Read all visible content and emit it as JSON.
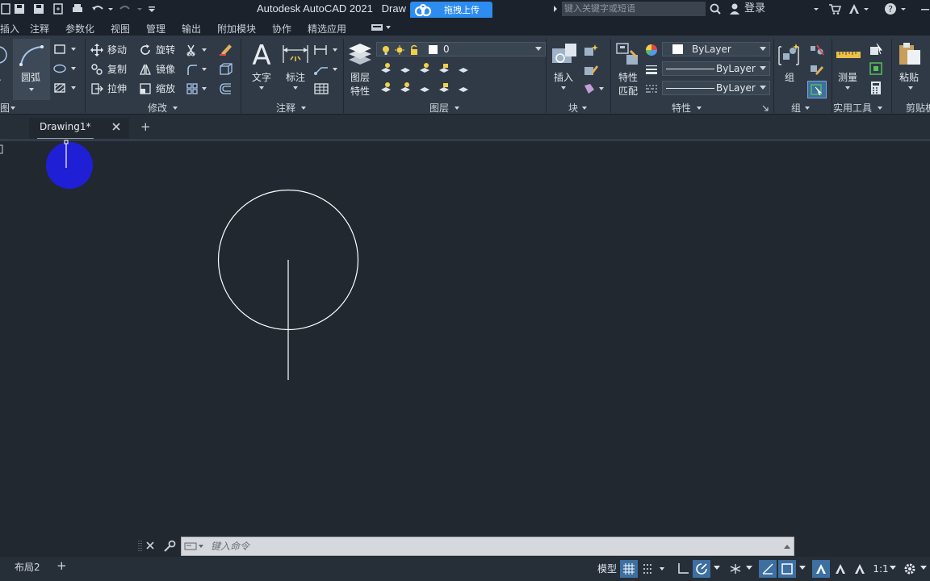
{
  "titlebar": {
    "title": "Autodesk AutoCAD 2021",
    "title_doc": "Draw",
    "upload_label": "拖拽上传",
    "search_placeholder": "键入关键字或短语",
    "login": "登录"
  },
  "menu": {
    "items": [
      "插入",
      "注释",
      "参数化",
      "视图",
      "管理",
      "输出",
      "附加模块",
      "协作",
      "精选应用"
    ]
  },
  "ribbon": {
    "draw": {
      "arc_label": "圆弧",
      "title": "图"
    },
    "modify": {
      "move": "移动",
      "rotate": "旋转",
      "copy": "复制",
      "mirror": "镜像",
      "stretch": "拉伸",
      "scale": "缩放",
      "title": "修改"
    },
    "annotation": {
      "text": "文字",
      "dimension": "标注",
      "title": "注释"
    },
    "layers": {
      "layer_props": "图层",
      "layer_props2": "特性",
      "current_layer": "0",
      "title": "图层"
    },
    "block": {
      "insert": "插入",
      "title": "块"
    },
    "properties": {
      "match": "特性",
      "match2": "匹配",
      "color": "ByLayer",
      "linetype": "ByLayer",
      "lineweight": "ByLayer",
      "title": "特性"
    },
    "groups": {
      "group": "组",
      "title": "组"
    },
    "utilities": {
      "measure": "测量",
      "title": "实用工具"
    },
    "clipboard": {
      "paste": "粘贴",
      "title": "剪贴板"
    }
  },
  "tabs": {
    "doc": "Drawing1*",
    "add": "+"
  },
  "command": {
    "placeholder": "键入命令"
  },
  "status": {
    "layout2": "布局2",
    "add": "+",
    "model": "模型",
    "scale": "1:1"
  },
  "colors": {
    "canvas": "#212830",
    "ribbon": "#2f3a46",
    "accent_blue": "#2d8cf0",
    "cursor_dot": "#1f1fd6"
  }
}
